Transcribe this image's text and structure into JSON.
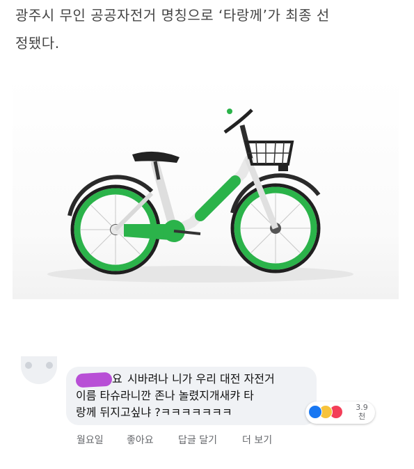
{
  "article": {
    "headline": "광주시 무인 공공자전거 명칭으로 ‘타랑께’가 최종 선\n정됐다."
  },
  "comment": {
    "author_suffix": "요",
    "text_line1": "시바려나 니가 우리 대전 자전거",
    "text_line2": "이름 타슈라니깐 존나 놀렸지개새캬 타",
    "text_line3": "랑께 뒤지고싶냐 ?ㅋㅋㅋㅋㅋㅋㅋ",
    "reactions": {
      "icons": [
        "like-icon",
        "haha-icon",
        "love-icon"
      ],
      "count": "3.9\n천"
    },
    "actions": {
      "time": "월요일",
      "like": "좋아요",
      "reply": "답글 달기",
      "more": "더 보기"
    }
  },
  "colors": {
    "bike_green": "#2bb34a",
    "comment_bg": "#f0f2f5",
    "like_blue": "#1877f2",
    "name_mask": "#b84fd6"
  }
}
